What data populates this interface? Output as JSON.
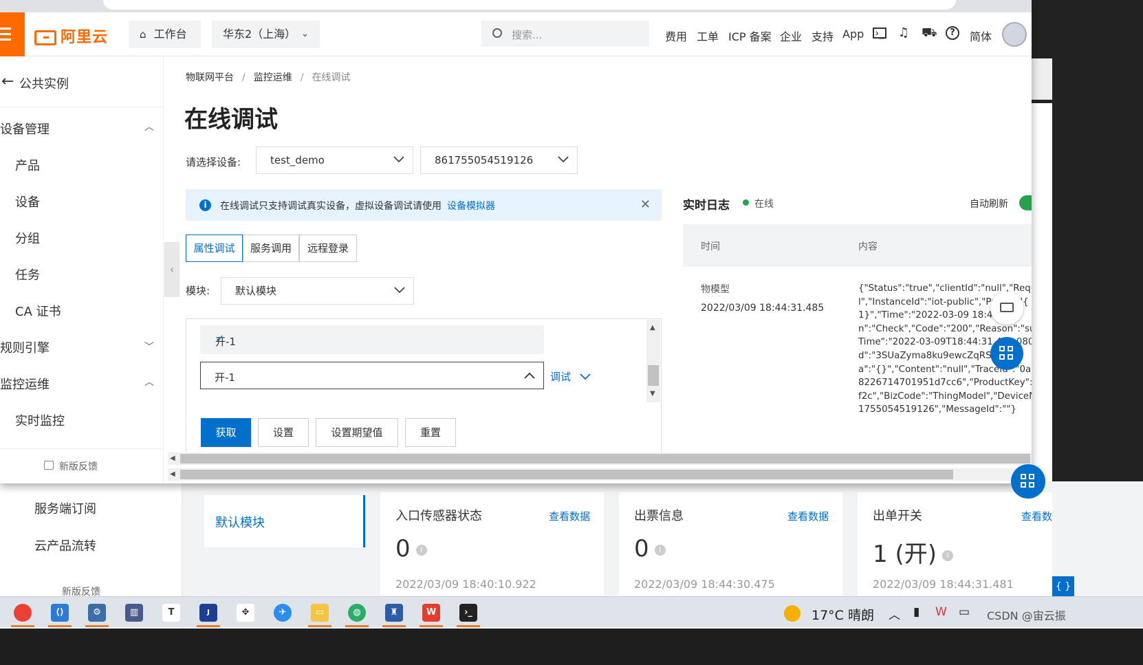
{
  "topbar": {
    "logo": "阿里云",
    "workbench": "工作台",
    "region": "华东2（上海）",
    "search_placeholder": "搜索...",
    "links": [
      "费用",
      "工单",
      "ICP 备案",
      "企业",
      "支持",
      "App"
    ],
    "lang": "简体"
  },
  "sidebar": {
    "back_label": "公共实例",
    "group_device": "设备管理",
    "items_device": [
      "产品",
      "设备",
      "分组",
      "任务",
      "CA 证书"
    ],
    "group_rules": "规则引擎",
    "group_monitor": "监控运维",
    "item_monitor": "实时监控",
    "feedback": "新版反馈"
  },
  "breadcrumb": [
    "物联网平台",
    "监控运维",
    "在线调试"
  ],
  "page_title": "在线调试",
  "device_select": {
    "label": "请选择设备:",
    "product": "test_demo",
    "device": "861755054519126"
  },
  "notice": {
    "text": "在线调试只支持调试真实设备，虚拟设备调试请使用",
    "link": "设备模拟器"
  },
  "tabs": [
    "属性调试",
    "服务调用",
    "远程登录"
  ],
  "module": {
    "label": "模块:",
    "value": "默认模块"
  },
  "dropdown": {
    "option": "开-1",
    "value": "开-1",
    "debug_label": "调试"
  },
  "buttons": {
    "get": "获取",
    "set": "设置",
    "set_expected": "设置期望值",
    "reset": "重置"
  },
  "log": {
    "title": "实时日志",
    "status": "在线",
    "auto_refresh": "自动刷新",
    "col_time": "时间",
    "col_content": "内容",
    "row_type": "物模型",
    "row_time": "2022/03/09 18:44:31.485",
    "row_content": "{\"Status\":\"true\",\"clientId\":\"null\",\"Reque\nl\",\"InstanceId\":\"iot-public\",\"Pa     \":\"{\n1}\",\"Time\":\"2022-03-09 18:44     \",\nn\":\"Check\",\"Code\":\"200\",\"Reason\":\"su\nTime\":\"2022-03-09T18:44:31.4     080\nd\":\"3SUaZyma8ku9ewcZqRS     \",\na\":\"{}\",\"Content\":\"null\",\"TraceId\":\"0a30\n8226714701951d7cc6\",\"ProductKey\":\"\nf2c\",\"BizCode\":\"ThingModel\",\"DeviceN\n1755054519126\",\"MessageId\":\"\"}"
  },
  "back": {
    "nav": [
      "服务端订阅",
      "云产品流转"
    ],
    "feedback": "新版反馈",
    "module": "默认模块",
    "cards": [
      {
        "title": "入口传感器状态",
        "link": "查看数据",
        "value": "0",
        "date": "2022/03/09 18:40:10.922"
      },
      {
        "title": "出票信息",
        "link": "查看数据",
        "value": "0",
        "date": "2022/03/09 18:44:30.475"
      },
      {
        "title": "出单开关",
        "link": "查看数",
        "value": "1 (开)",
        "date": "2022/03/09 18:44:31.481"
      }
    ]
  },
  "taskbar": {
    "weather": "17°C 晴朗",
    "tray_text": "CSDN @宙云振"
  },
  "icons": {
    "home": "home-icon",
    "search": "search-icon",
    "terminal": "terminal-icon",
    "bell": "bell-icon",
    "cart": "cart-icon",
    "help": "help-icon"
  },
  "colors": {
    "accent": "#0070cc",
    "brand": "#ff6a00",
    "online": "#23a34a"
  }
}
